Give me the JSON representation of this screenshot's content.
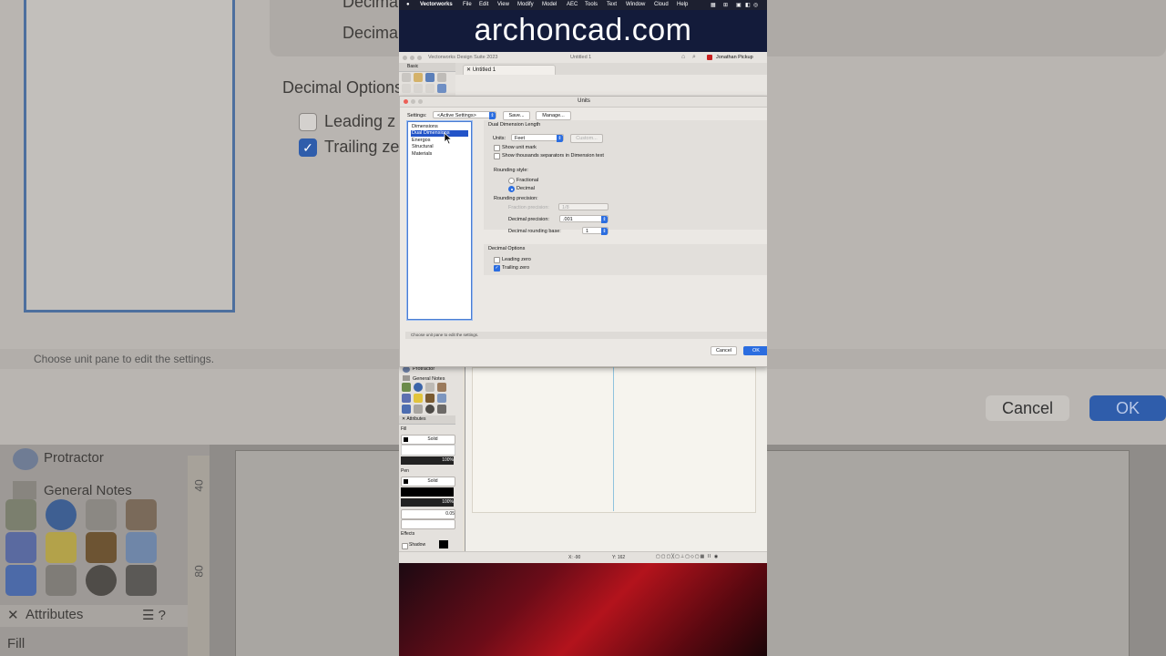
{
  "background": {
    "decimal_label_partial": "Decima",
    "decimal_label_top": "Decima",
    "decimal_options": "Decimal Options",
    "leading_zero": "Leading z",
    "trailing_zero": "Trailing ze",
    "status_hint": "Choose unit pane to edit the settings.",
    "cancel": "Cancel",
    "ok": "OK",
    "protractor": "Protractor",
    "general_notes": "General Notes",
    "attributes": "Attributes",
    "attributes_icons": "☰ ?",
    "fill": "Fill",
    "ruler_marks": [
      "40",
      "80"
    ]
  },
  "banner": {
    "text": "archoncad.com"
  },
  "menubar": {
    "apple": "",
    "app": "Vectorworks",
    "items": [
      "File",
      "Edit",
      "View",
      "Modify",
      "Model",
      "AEC",
      "Tools",
      "Text",
      "Window",
      "Cloud",
      "Help"
    ]
  },
  "app": {
    "suite_title": "Vectorworks Design Suite 2023",
    "doc_title": "Untitled 1",
    "user": "Jonathan Pickup",
    "tab_label": "Untitled 1",
    "palette_basic": "Basic",
    "palette_protractor": "Protractor",
    "palette_general_notes": "General Notes",
    "attributes_title": "Attributes",
    "fill_label": "Fill",
    "fill_style": "Solid",
    "fill_opacity": "100%",
    "pen_label": "Pen",
    "pen_style": "Solid",
    "pen_opacity": "100%",
    "line_weight": "0.05",
    "effects_label": "Effects",
    "shadow_label": "Shadow",
    "status_x": "X: -90",
    "status_y": "Y: 162"
  },
  "dialog": {
    "title": "Units",
    "settings_label": "Settings:",
    "settings_value": "<Active Settings>",
    "save_button": "Save...",
    "manage_button": "Manage...",
    "panes": [
      "Dimensions",
      "Dual Dimensions",
      "Energos",
      "Structural",
      "Materials"
    ],
    "selected_pane": "Dual Dimensions",
    "group_title": "Dual Dimension Length",
    "units_label": "Units:",
    "units_value": "Feet",
    "custom_button": "Custom...",
    "show_unit_mark": "Show unit mark",
    "show_thousands": "Show thousands separators in Dimension text",
    "rounding_style": "Rounding style:",
    "fractional": "Fractional",
    "decimal": "Decimal",
    "rounding_precision": "Rounding precision:",
    "fraction_precision_label": "Fraction precision:",
    "fraction_precision_value": "1/8",
    "decimal_precision_label": "Decimal precision:",
    "decimal_precision_value": ".001",
    "decimal_rounding_base_label": "Decimal rounding base:",
    "decimal_rounding_base_value": "1",
    "decimal_options_title": "Decimal Options",
    "leading_zero": "Leading zero",
    "trailing_zero": "Trailing zero",
    "leading_zero_checked": false,
    "trailing_zero_checked": true,
    "status_hint": "Choose unit pane to edit the settings.",
    "cancel_button": "Cancel",
    "ok_button": "OK"
  },
  "colors": {
    "accent": "#2b6de0",
    "banner_bg": "#131b3a",
    "selection": "#2354c8"
  }
}
